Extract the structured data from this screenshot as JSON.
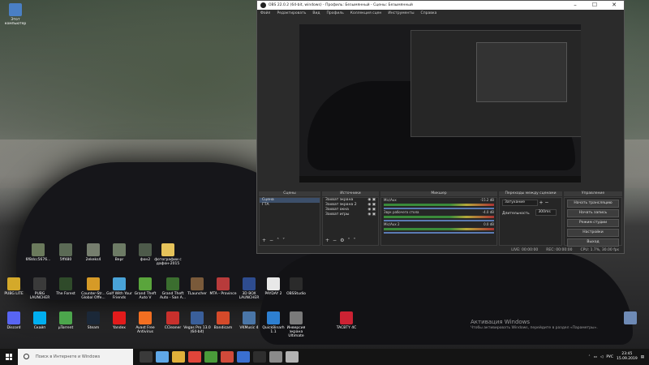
{
  "desktop": {
    "icons_top": [
      {
        "label": "Этот компьютер",
        "color": "#4a7fc4"
      },
      {
        "label": "6f8dcc5676...",
        "color": "#6b7a5c"
      },
      {
        "label": "5ff480",
        "color": "#5b6a55"
      },
      {
        "label": "2ekeks4",
        "color": "#767e6e"
      },
      {
        "label": "Bepr",
        "color": "#6d7b65"
      },
      {
        "label": "фон2",
        "color": "#4d5a4a"
      },
      {
        "label": "фотографии с дафон-2015",
        "color": "#e6c35a"
      }
    ],
    "icons_row2": [
      {
        "label": "PUBG LITE",
        "color": "#d4a92a"
      },
      {
        "label": "PUBG LAUNCHER",
        "color": "#3a3a3a"
      },
      {
        "label": "The Forest",
        "color": "#2f4a2a"
      },
      {
        "label": "Counter-Str... Global Offe...",
        "color": "#d69a27"
      },
      {
        "label": "Golf With Your Friends",
        "color": "#49a3d8"
      },
      {
        "label": "Grand Theft Auto V",
        "color": "#5aa53c"
      },
      {
        "label": "Grand Theft Auto - San A...",
        "color": "#3b6e2f"
      },
      {
        "label": "TLauncher",
        "color": "#7a5a3a"
      },
      {
        "label": "MTA - Province",
        "color": "#b83b3b"
      },
      {
        "label": "3D BOX LAUNCHER",
        "color": "#2e4c8f"
      },
      {
        "label": "PAYDAY 2",
        "color": "#e8e8e8"
      },
      {
        "label": "OBSStudio",
        "color": "#2b2b2b"
      }
    ],
    "icons_row3": [
      {
        "label": "Discord",
        "color": "#5865f2"
      },
      {
        "label": "Скайп",
        "color": "#00aff0"
      },
      {
        "label": "µTorrent",
        "color": "#4ca64c"
      },
      {
        "label": "Steam",
        "color": "#1b2838"
      },
      {
        "label": "Yandex",
        "color": "#e21b1b"
      },
      {
        "label": "Avast Free Antivirus",
        "color": "#f36f21"
      },
      {
        "label": "CCleaner",
        "color": "#c9302c"
      },
      {
        "label": "Vegas Pro 13.0 (64-bit)",
        "color": "#3a5f9a"
      },
      {
        "label": "Bandicam",
        "color": "#d54a2a"
      },
      {
        "label": "VKMusic 4",
        "color": "#4a76a8"
      },
      {
        "label": "QuickBinarh 1.1",
        "color": "#2d7fd1"
      },
      {
        "label": "Инверсия экрана Ultimate",
        "color": "#7a7a7a"
      },
      {
        "label": "TACBTY 4C",
        "color": "#c23"
      },
      {
        "label": "",
        "color": "#6e8ab5"
      }
    ],
    "watermark_title": "Активация Windows",
    "watermark_sub": "Чтобы активировать Windows, перейдите в раздел «Параметры»."
  },
  "obs": {
    "title": "OBS 22.0.2 (64-bit, windows) - Профиль: Безымянный - Сцены: Безымянный",
    "menu": [
      "Файл",
      "Редактировать",
      "Вид",
      "Профиль",
      "Коллекция сцен",
      "Инструменты",
      "Справка"
    ],
    "scenes_header": "Сцены",
    "scenes": [
      "Сцена",
      "ГТА"
    ],
    "sources_header": "Источники",
    "sources": [
      "Захват экрана",
      "Захват экрана 2",
      "Захват окна",
      "Захват игры"
    ],
    "mixer_header": "Микшер",
    "mixer": [
      {
        "name": "Mic/Aux",
        "db": "-15.2 dB"
      },
      {
        "name": "Звук рабочего стола",
        "db": "-4.0 dB"
      },
      {
        "name": "Mic/Aux 2",
        "db": "0.0 dB"
      }
    ],
    "transitions_header": "Переходы между сценами",
    "transitions": {
      "type_value": "Затухание",
      "duration_label": "Длительность",
      "duration_value": "300ms"
    },
    "controls_header": "Управление",
    "controls": [
      "Начать трансляцию",
      "Начать запись",
      "Режим студии",
      "Настройки",
      "Выход"
    ],
    "status": {
      "live": "LIVE: 00:00:00",
      "rec": "REC: 00:00:00",
      "cpu": "CPU: 1.7%, 30.00 fps"
    }
  },
  "taskbar": {
    "search_placeholder": "Поиск в Интернете и Windows",
    "apps": [
      "#3a3a3a",
      "#5fa8e8",
      "#e0b03a",
      "#e0453a",
      "#4a9b3a",
      "#d04a3a",
      "#3a6fd0",
      "#2e2e2e",
      "#8a8a8a",
      "#b3b3b3"
    ],
    "lang": "РУС",
    "time": "23:45",
    "date": "15.09.2019"
  }
}
